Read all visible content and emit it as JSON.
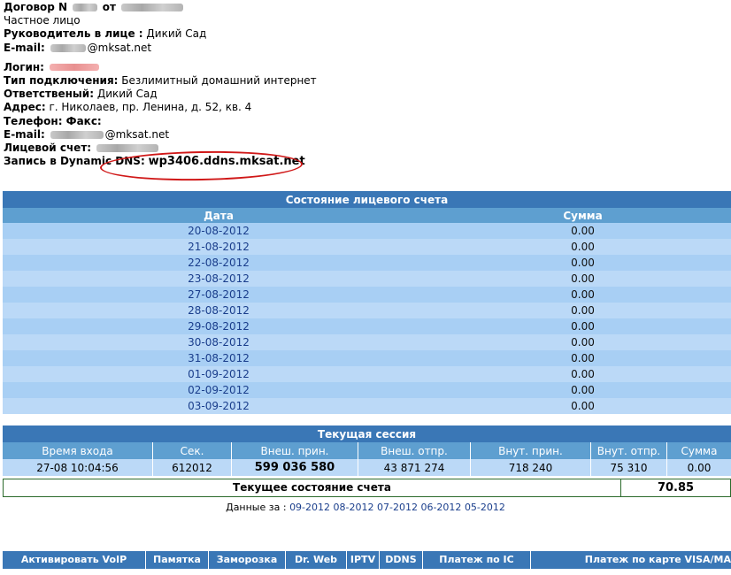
{
  "contract": {
    "contract_label": "Договор N",
    "contract_from": "от",
    "person_type": "Частное лицо",
    "head_label": "Руководитель в лице :",
    "head_value": "Дикий Сад",
    "email_label": "E-mail:",
    "email_domain": "@mksat.net"
  },
  "details": {
    "login_label": "Логин:",
    "connection_label": "Тип подключения:",
    "connection_value": "Безлимитный домашний интернет",
    "responsible_label": "Ответственый:",
    "responsible_value": "Дикий Сад",
    "address_label": "Адрес:",
    "address_value": "г. Николаев, пр. Ленина, д. 52, кв. 4",
    "phone_label": "Телефон: Факс:",
    "email_label": "E-mail:",
    "email_domain": "@mksat.net",
    "account_label": "Лицевой счет:",
    "dns_label": "Запись в Dynamic DNS:",
    "dns_value": "wp3406.ddns.mksat.net"
  },
  "account_table": {
    "title": "Состояние лицевого счета",
    "col_date": "Дата",
    "col_sum": "Сумма",
    "rows": [
      {
        "date": "20-08-2012",
        "sum": "0.00"
      },
      {
        "date": "21-08-2012",
        "sum": "0.00"
      },
      {
        "date": "22-08-2012",
        "sum": "0.00"
      },
      {
        "date": "23-08-2012",
        "sum": "0.00"
      },
      {
        "date": "27-08-2012",
        "sum": "0.00"
      },
      {
        "date": "28-08-2012",
        "sum": "0.00"
      },
      {
        "date": "29-08-2012",
        "sum": "0.00"
      },
      {
        "date": "30-08-2012",
        "sum": "0.00"
      },
      {
        "date": "31-08-2012",
        "sum": "0.00"
      },
      {
        "date": "01-09-2012",
        "sum": "0.00"
      },
      {
        "date": "02-09-2012",
        "sum": "0.00"
      },
      {
        "date": "03-09-2012",
        "sum": "0.00"
      }
    ]
  },
  "session": {
    "title": "Текущая сессия",
    "headers": [
      "Время входа",
      "Сек.",
      "Внеш. прин.",
      "Внеш. отпр.",
      "Внут. прин.",
      "Внут. отпр.",
      "Сумма"
    ],
    "values": [
      "27-08 10:04:56",
      "612012",
      "599 036 580",
      "43 871 274",
      "718 240",
      "75 310",
      "0.00"
    ]
  },
  "balance": {
    "label": "Текущее состояние счета",
    "value": "70.85"
  },
  "period": {
    "label": "Данные за :",
    "links": [
      "09-2012",
      "08-2012",
      "07-2012",
      "06-2012",
      "05-2012"
    ]
  },
  "nav": {
    "items": [
      "Активировать VoIP",
      "Памятка",
      "Заморозка",
      "Dr. Web",
      "IPTV",
      "DDNS",
      "Платеж по IC",
      "Платеж по карте VISA/MA"
    ]
  },
  "colors": {
    "header_blue": "#3a77b6",
    "subheader_blue": "#5e9fd0",
    "row_light": "#bbd9f7",
    "row_dark": "#a8cff4",
    "link_blue": "#1a3e8c",
    "highlight_red": "#d01818"
  }
}
